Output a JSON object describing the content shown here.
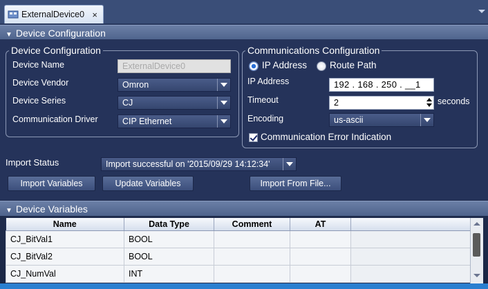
{
  "tab": {
    "label": "ExternalDevice0",
    "close": "×"
  },
  "sections": {
    "device_configuration": "Device Configuration",
    "device_variables": "Device Variables"
  },
  "device_config": {
    "group_title": "Device Configuration",
    "name_label": "Device Name",
    "name_value": "ExternalDevice0",
    "vendor_label": "Device Vendor",
    "vendor_value": "Omron",
    "series_label": "Device Series",
    "series_value": "CJ",
    "driver_label": "Communication Driver",
    "driver_value": "CIP Ethernet"
  },
  "comm_config": {
    "group_title": "Communications Configuration",
    "radio_ip": "IP Address",
    "radio_route": "Route Path",
    "ip_label": "IP Address",
    "ip_value": "192 . 168 . 250 . __1",
    "timeout_label": "Timeout",
    "timeout_value": "2",
    "timeout_unit": "seconds",
    "encoding_label": "Encoding",
    "encoding_value": "us-ascii",
    "error_indication": "Communication Error Indication"
  },
  "import": {
    "status_label": "Import Status",
    "status_value": "Import successful on '2015/09/29 14:12:34'",
    "import_variables": "Import Variables",
    "update_variables": "Update Variables",
    "import_from_file": "Import From File..."
  },
  "variables_table": {
    "columns": [
      "Name",
      "Data Type",
      "Comment",
      "AT"
    ],
    "rows": [
      {
        "name": "CJ_BitVal1",
        "data_type": "BOOL",
        "comment": "",
        "at": ""
      },
      {
        "name": "CJ_BitVal2",
        "data_type": "BOOL",
        "comment": "",
        "at": ""
      },
      {
        "name": "CJ_NumVal",
        "data_type": "INT",
        "comment": "",
        "at": ""
      }
    ]
  },
  "colors": {
    "panel_bg": "#25335a",
    "section_header": "#4e638c",
    "accent_blue": "#2a6fd6"
  }
}
